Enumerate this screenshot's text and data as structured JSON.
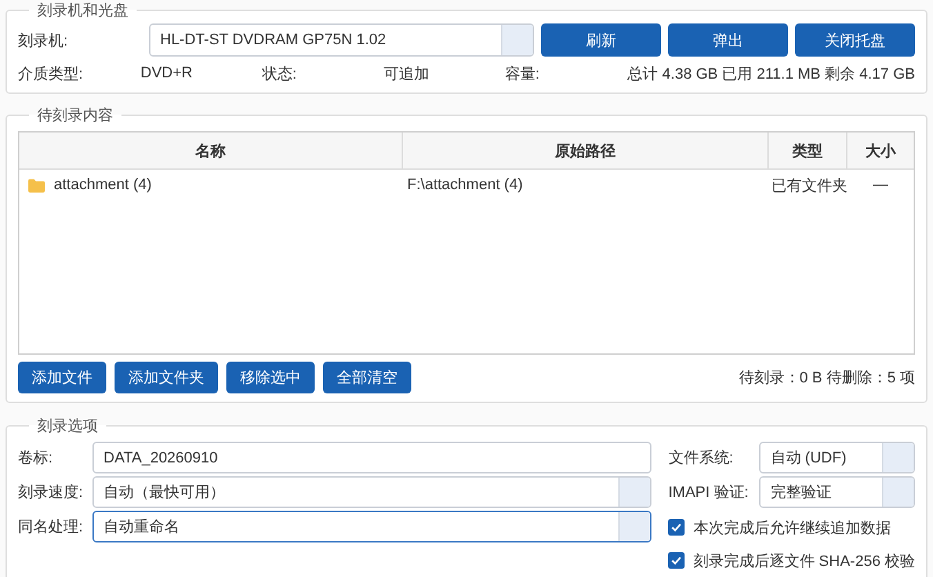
{
  "drive_group": {
    "title": "刻录机和光盘",
    "drive_label": "刻录机:",
    "drive": {
      "value": "HL-DT-ST DVDRAM GP75N 1.02"
    },
    "buttons": [
      "刷新",
      "弹出",
      "关闭托盘"
    ],
    "info": [
      {
        "label": "介质类型:",
        "value": "DVD+R"
      },
      {
        "label": "状态:",
        "value": "可追加"
      },
      {
        "label": "容量:",
        "value": "总计 4.38 GB   已用 211.1 MB   剩余 4.17 GB"
      }
    ]
  },
  "content_group": {
    "title": "待刻录内容",
    "table": {
      "columns": [
        "名称",
        "原始路径",
        "类型",
        "大小"
      ],
      "rows": [
        {
          "name": "attachment (4)",
          "path": "F:\\attachment (4)",
          "type": "已有文件夹",
          "size": "—",
          "selected": false
        }
      ]
    },
    "buttons": [
      "添加文件",
      "添加文件夹",
      "移除选中",
      "全部清空"
    ],
    "summary": "待刻录：0 B   待删除：5 项"
  },
  "options_group": {
    "title": "刻录选项",
    "fields": [
      {
        "label": "卷标:",
        "value": "DATA_20260910",
        "kind": "text",
        "focused": false
      },
      {
        "label": "刻录速度:",
        "value": "自动（最快可用）",
        "kind": "combo",
        "focused": false
      },
      {
        "label": "同名处理:",
        "value": "自动重命名",
        "kind": "combo",
        "focused": true
      }
    ],
    "right_fields": [
      {
        "label": "文件系统:",
        "value": "自动 (UDF)",
        "kind": "combo",
        "focused": false
      },
      {
        "label": "IMAPI 验证:",
        "value": "完整验证",
        "kind": "combo",
        "focused": false
      }
    ],
    "checks": [
      {
        "label": "本次完成后允许继续追加数据",
        "checked": true
      },
      {
        "label": "刻录完成后逐文件 SHA-256 校验",
        "checked": true
      }
    ]
  }
}
